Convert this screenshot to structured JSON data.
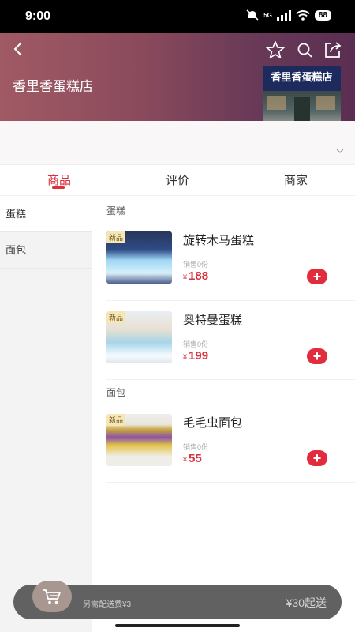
{
  "status_bar": {
    "time": "9:00",
    "network": "5G",
    "battery": "88"
  },
  "shop": {
    "name": "香里香蛋糕店",
    "sign_text": "香里香蛋糕店"
  },
  "tabs": [
    {
      "label": "商品",
      "active": true
    },
    {
      "label": "评价",
      "active": false
    },
    {
      "label": "商家",
      "active": false
    }
  ],
  "sidebar": {
    "items": [
      {
        "label": "蛋糕",
        "active": true
      },
      {
        "label": "面包",
        "active": false
      }
    ]
  },
  "sections": [
    {
      "title": "蛋糕",
      "products": [
        {
          "badge": "新品",
          "name": "旋转木马蛋糕",
          "sold": "销售0份",
          "currency": "¥",
          "price": "188"
        },
        {
          "badge": "新品",
          "name": "奥特曼蛋糕",
          "sold": "销售0份",
          "currency": "¥",
          "price": "199"
        }
      ]
    },
    {
      "title": "面包",
      "products": [
        {
          "badge": "新品",
          "name": "毛毛虫面包",
          "sold": "销售0份",
          "currency": "¥",
          "price": "55"
        }
      ]
    }
  ],
  "cart": {
    "delivery_note": "另需配送费¥3",
    "min_order": "¥30起送"
  },
  "colors": {
    "accent": "#d8313f",
    "add_button": "#e02c3c",
    "header_start": "#a05a64",
    "header_end": "#5a2e52"
  }
}
